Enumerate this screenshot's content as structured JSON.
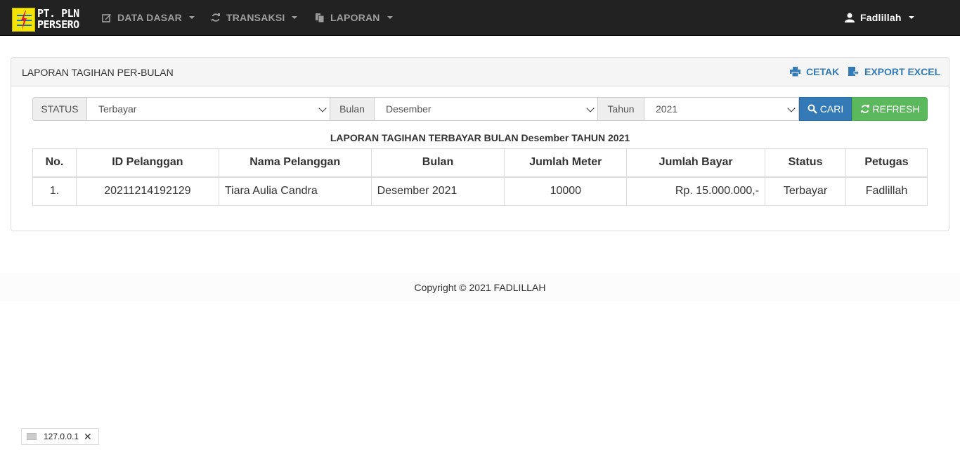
{
  "brand": {
    "line1": "PT. PLN",
    "line2": "PERSERO"
  },
  "nav": {
    "items": [
      {
        "label": "DATA DASAR",
        "icon": "edit-icon"
      },
      {
        "label": "TRANSAKSI",
        "icon": "refresh-icon"
      },
      {
        "label": "LAPORAN",
        "icon": "documents-icon"
      }
    ],
    "user": {
      "label": "Fadlillah",
      "icon": "user-icon"
    }
  },
  "panel": {
    "title": "LAPORAN TAGIHAN PER-BULAN",
    "print_label": "CETAK",
    "export_label": "EXPORT EXCEL"
  },
  "filter": {
    "status_label": "STATUS",
    "status_value": "Terbayar",
    "month_label": "Bulan",
    "month_value": "Desember",
    "year_label": "Tahun",
    "year_value": "2021",
    "search_label": "CARI",
    "refresh_label": "REFRESH"
  },
  "report_title": "LAPORAN TAGIHAN TERBAYAR BULAN Desember TAHUN 2021",
  "table": {
    "headers": [
      "No.",
      "ID Pelanggan",
      "Nama Pelanggan",
      "Bulan",
      "Jumlah Meter",
      "Jumlah Bayar",
      "Status",
      "Petugas"
    ],
    "rows": [
      [
        "1.",
        "20211214192129",
        "Tiara Aulia Candra",
        "Desember 2021",
        "10000",
        "Rp. 15.000.000,-",
        "Terbayar",
        "Fadlillah"
      ]
    ]
  },
  "footer": {
    "text": "Copyright © 2021 FADLILLAH"
  },
  "status_chip": {
    "text": "127.0.0.1"
  },
  "colors": {
    "navbar": "#222222",
    "primary": "#337ab7",
    "success": "#5cb85c"
  }
}
